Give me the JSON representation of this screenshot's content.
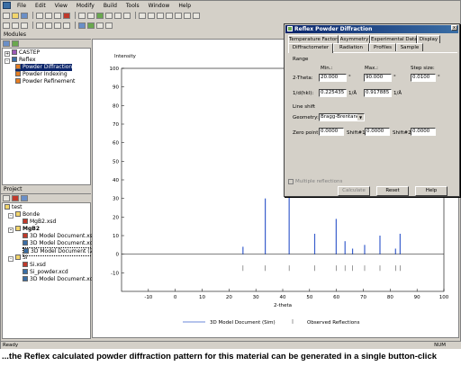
{
  "menu": [
    "File",
    "Edit",
    "View",
    "Modify",
    "Build",
    "Tools",
    "Window",
    "Help"
  ],
  "modules_panel": {
    "title": "Modules",
    "items": [
      {
        "label": "CASTEP",
        "expander": "+"
      },
      {
        "label": "Reflex",
        "expander": "-"
      },
      {
        "label": "Powder Diffraction",
        "selected": true
      },
      {
        "label": "Powder Indexing"
      },
      {
        "label": "Powder Refinement"
      }
    ]
  },
  "project_panel": {
    "title": "Project",
    "items": [
      {
        "label": "test"
      },
      {
        "label": "Bonde"
      },
      {
        "label": "MgB2.xsd"
      },
      {
        "label": "MgB2"
      },
      {
        "label": "3D Model Document.xsd"
      },
      {
        "label": "3D Model Document.xcd"
      },
      {
        "label": "3D Model Document (2).xcd"
      },
      {
        "label": "Si"
      },
      {
        "label": "Si.xsd"
      },
      {
        "label": "Si_powder.xcd"
      },
      {
        "label": "3D Model Document.xcd"
      }
    ]
  },
  "dialog": {
    "title": "Reflex Powder Diffraction",
    "close": "x",
    "tabs_row1": [
      "Temperature Factors",
      "Asymmetry",
      "Experimental Data",
      "Display"
    ],
    "tabs_row2": [
      "Diffractometer",
      "Radiation",
      "Profiles",
      "Sample"
    ],
    "range_label": "Range",
    "min_label": "Min.:",
    "max_label": "Max.:",
    "step_label": "Step size:",
    "two_theta_label": "2-Theta:",
    "two_theta_min": "20.000",
    "two_theta_max": "90.000",
    "step_size": "0.0100",
    "deg1": "°",
    "deg2": "°",
    "deg3": "°",
    "invd_label": "1/d(hkl):",
    "invd_min": "0.225435",
    "invd_max": "0.917885",
    "unit1": "1/Å",
    "unit2": "1/Å",
    "line_shift_label": "Line shift",
    "geometry_label": "Geometry:",
    "geometry_value": "Bragg-Brentano",
    "zero_point_label": "Zero point:",
    "zero_point_value": "0.0000",
    "shift1_label": "Shift#1:",
    "shift1_value": "0.0000",
    "shift2_label": "Shift#2:",
    "shift2_value": "0.0000",
    "multiple_label": "Multiple reflections",
    "calculate": "Calculate",
    "reset": "Reset",
    "help": "Help"
  },
  "status": {
    "left": "Ready",
    "num": "NUM"
  },
  "caption": "...the Reflex calculated powder diffraction pattern for this material can be generated in a single button-click",
  "chart_data": {
    "type": "line",
    "ylabel": "Intensity",
    "xlabel": "2-theta",
    "xlim": [
      -20,
      100
    ],
    "ylim": [
      -20,
      100
    ],
    "x_ticks": [
      -10,
      0,
      10,
      20,
      30,
      40,
      50,
      60,
      70,
      80,
      90,
      100
    ],
    "y_ticks": [
      -10,
      0,
      10,
      20,
      30,
      40,
      50,
      60,
      70,
      80,
      90,
      100
    ],
    "series": [
      {
        "name": "3D Model Document (Sim)",
        "peaks": [
          [
            25.2,
            4
          ],
          [
            33.5,
            30
          ],
          [
            42.4,
            92
          ],
          [
            51.9,
            11
          ],
          [
            59.9,
            19
          ],
          [
            63.2,
            7
          ],
          [
            66.0,
            3
          ],
          [
            70.5,
            5
          ],
          [
            76.2,
            10
          ],
          [
            82.0,
            3
          ],
          [
            83.7,
            11
          ]
        ]
      },
      {
        "name": "Observed Reflections",
        "positions": [
          25.2,
          33.5,
          42.4,
          51.9,
          59.9,
          63.2,
          66.0,
          70.5,
          76.2,
          82.0,
          83.7
        ]
      }
    ]
  }
}
